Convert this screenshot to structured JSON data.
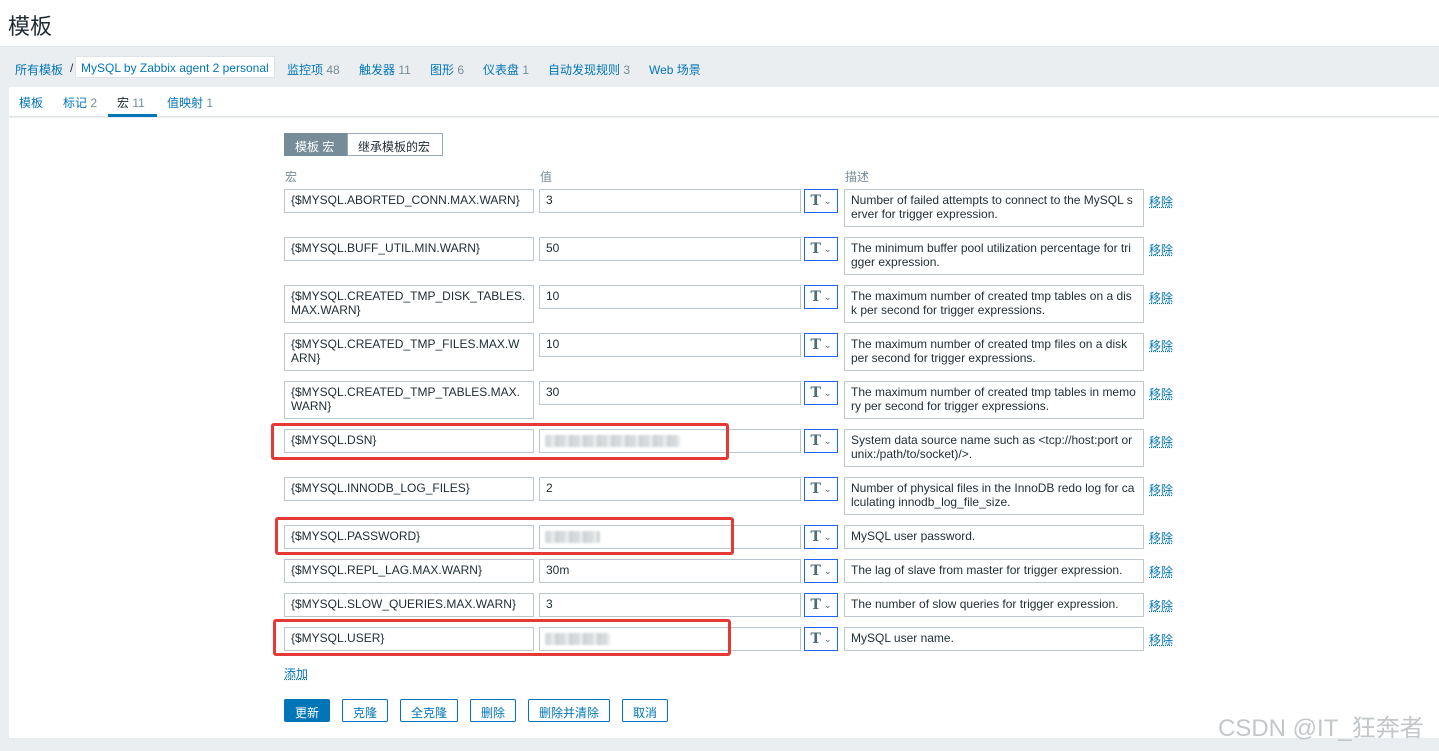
{
  "header": {
    "title": "模板"
  },
  "breadcrumb": {
    "all_templates": "所有模板",
    "separator": "/",
    "current": "MySQL by Zabbix agent 2 personal"
  },
  "nav": [
    {
      "label": "监控项",
      "count": "48"
    },
    {
      "label": "触发器",
      "count": "11"
    },
    {
      "label": "图形",
      "count": "6"
    },
    {
      "label": "仪表盘",
      "count": "1"
    },
    {
      "label": "自动发现规则",
      "count": "3"
    },
    {
      "label": "Web 场景",
      "count": ""
    }
  ],
  "tabs": [
    {
      "label": "模板",
      "count": ""
    },
    {
      "label": "标记",
      "count": "2"
    },
    {
      "label": "宏",
      "count": "11"
    },
    {
      "label": "值映射",
      "count": "1"
    }
  ],
  "toggle": {
    "template_macros": "模板 宏",
    "inherited_macros": "继承模板的宏"
  },
  "columns": {
    "macro": "宏",
    "value": "值",
    "description": "描述"
  },
  "type_glyph": "T",
  "chevron": "⌄",
  "remove_label": "移除",
  "macros": [
    {
      "macro": "{$MYSQL.ABORTED_CONN.MAX.WARN}",
      "value": "3",
      "description": "Number of failed attempts to connect to the MySQL server for trigger expression."
    },
    {
      "macro": "{$MYSQL.BUFF_UTIL.MIN.WARN}",
      "value": "50",
      "description": "The minimum buffer pool utilization percentage for trigger expression."
    },
    {
      "macro": "{$MYSQL.CREATED_TMP_DISK_TABLES.MAX.WARN}",
      "value": "10",
      "description": "The maximum number of created tmp tables on a disk per second for trigger expressions."
    },
    {
      "macro": "{$MYSQL.CREATED_TMP_FILES.MAX.WARN}",
      "value": "10",
      "description": "The maximum number of created tmp files on a disk per second for trigger expressions."
    },
    {
      "macro": "{$MYSQL.CREATED_TMP_TABLES.MAX.WARN}",
      "value": "30",
      "description": "The maximum number of created tmp tables in memory per second for trigger expressions."
    },
    {
      "macro": "{$MYSQL.DSN}",
      "value": "",
      "description": "System data source name such as <tcp://host:port or unix:/path/to/socket)/>."
    },
    {
      "macro": "{$MYSQL.INNODB_LOG_FILES}",
      "value": "2",
      "description": "Number of physical files in the InnoDB redo log for calculating innodb_log_file_size."
    },
    {
      "macro": "{$MYSQL.PASSWORD}",
      "value": "",
      "description": "MySQL user password."
    },
    {
      "macro": "{$MYSQL.REPL_LAG.MAX.WARN}",
      "value": "30m",
      "description": "The lag of slave from master for trigger expression."
    },
    {
      "macro": "{$MYSQL.SLOW_QUERIES.MAX.WARN}",
      "value": "3",
      "description": "The number of slow queries for trigger expression."
    },
    {
      "macro": "{$MYSQL.USER}",
      "value": "",
      "description": "MySQL user name."
    }
  ],
  "add_label": "添加",
  "buttons": {
    "update": "更新",
    "clone": "克隆",
    "full_clone": "全克隆",
    "delete": "删除",
    "delete_and_clear": "删除并清除",
    "cancel": "取消"
  },
  "watermark": "CSDN @IT_狂奔者"
}
